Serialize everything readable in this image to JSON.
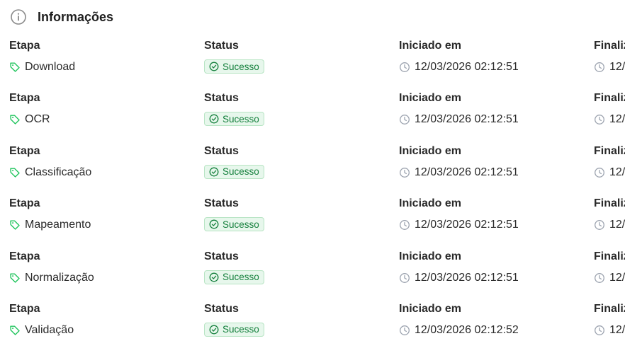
{
  "section": {
    "title": "Informações",
    "icon": "info-icon"
  },
  "columns": {
    "etapa": "Etapa",
    "status": "Status",
    "iniciado": "Iniciado em",
    "finalizado": "Finaliz"
  },
  "colors": {
    "success_bg": "#e7f7ec",
    "success_border": "#b7e4c3",
    "success_text": "#15803d",
    "tag_icon": "#22c55e",
    "muted_icon": "#9ca3af"
  },
  "rows": [
    {
      "etapa": "Download",
      "status": "Sucesso",
      "iniciado": "12/03/2026 02:12:51",
      "finalizado": "12/"
    },
    {
      "etapa": "OCR",
      "status": "Sucesso",
      "iniciado": "12/03/2026 02:12:51",
      "finalizado": "12/"
    },
    {
      "etapa": "Classificação",
      "status": "Sucesso",
      "iniciado": "12/03/2026 02:12:51",
      "finalizado": "12/"
    },
    {
      "etapa": "Mapeamento",
      "status": "Sucesso",
      "iniciado": "12/03/2026 02:12:51",
      "finalizado": "12/"
    },
    {
      "etapa": "Normalização",
      "status": "Sucesso",
      "iniciado": "12/03/2026 02:12:51",
      "finalizado": "12/"
    },
    {
      "etapa": "Validação",
      "status": "Sucesso",
      "iniciado": "12/03/2026 02:12:52",
      "finalizado": "12/"
    }
  ]
}
